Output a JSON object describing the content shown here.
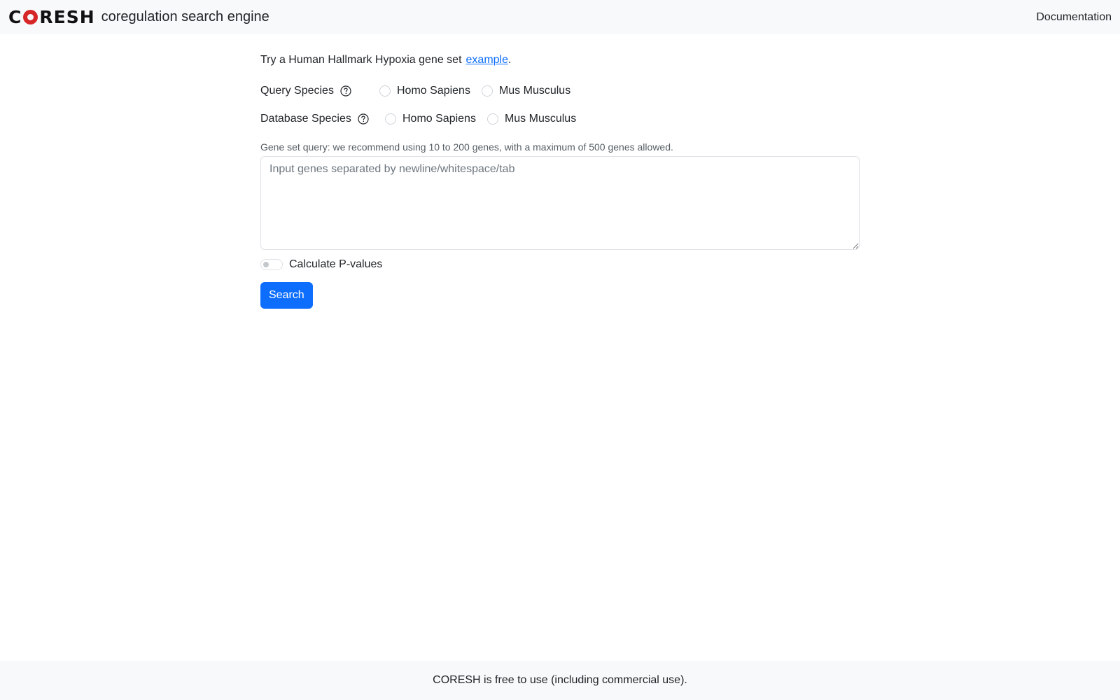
{
  "navbar": {
    "logo_left": "C",
    "logo_right": "RESH",
    "brand_text": "coregulation search engine",
    "documentation_link": "Documentation"
  },
  "intro": {
    "text": "Try a Human Hallmark Hypoxia gene set",
    "link_text": "example",
    "suffix": "."
  },
  "query_species": {
    "label": "Query Species",
    "icon": "question-circle-icon",
    "options": [
      "Homo Sapiens",
      "Mus Musculus"
    ],
    "selected": null
  },
  "database_species": {
    "label": "Database Species",
    "icon": "question-circle-icon",
    "options": [
      "Homo Sapiens",
      "Mus Musculus"
    ],
    "selected": null
  },
  "gene_query": {
    "hint": "Gene set query: we recommend using 10 to 200 genes, with a maximum of 500 genes allowed.",
    "placeholder": "Input genes separated by newline/whitespace/tab",
    "value": ""
  },
  "pvalues": {
    "label": "Calculate P-values",
    "enabled": false
  },
  "search_button": {
    "label": "Search"
  },
  "footer": {
    "text": "CORESH is free to use (including commercial use)."
  },
  "colors": {
    "accent": "#0d6efd",
    "logo_ring": "#d62728",
    "navbar_bg": "#f8f9fa"
  }
}
